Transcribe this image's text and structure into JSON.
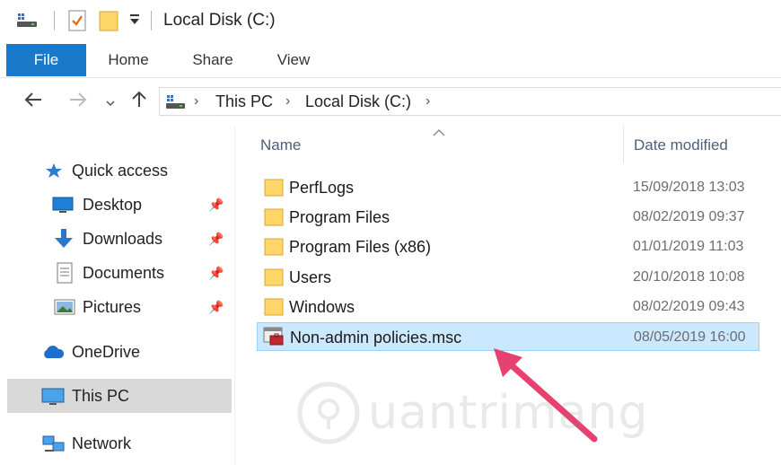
{
  "window": {
    "title": "Local Disk (C:)"
  },
  "ribbon": {
    "tabs": [
      {
        "label": "File"
      },
      {
        "label": "Home"
      },
      {
        "label": "Share"
      },
      {
        "label": "View"
      }
    ]
  },
  "address": {
    "crumbs": [
      "This PC",
      "Local Disk (C:)"
    ]
  },
  "sidebar": {
    "quick_access": "Quick access",
    "items": [
      {
        "label": "Desktop",
        "icon": "desktop-icon",
        "pinned": true
      },
      {
        "label": "Downloads",
        "icon": "download-arrow-icon",
        "pinned": true
      },
      {
        "label": "Documents",
        "icon": "documents-icon",
        "pinned": true
      },
      {
        "label": "Pictures",
        "icon": "pictures-icon",
        "pinned": true
      }
    ],
    "onedrive": "OneDrive",
    "this_pc": "This PC",
    "network": "Network"
  },
  "columns": {
    "name": "Name",
    "date_modified": "Date modified"
  },
  "files": [
    {
      "name": "PerfLogs",
      "date": "15/09/2018 13:03",
      "type": "folder"
    },
    {
      "name": "Program Files",
      "date": "08/02/2019 09:37",
      "type": "folder"
    },
    {
      "name": "Program Files (x86)",
      "date": "01/01/2019 11:03",
      "type": "folder"
    },
    {
      "name": "Users",
      "date": "20/10/2018 10:08",
      "type": "folder"
    },
    {
      "name": "Windows",
      "date": "08/02/2019 09:43",
      "type": "folder"
    },
    {
      "name": "Non-admin policies.msc",
      "date": "08/05/2019 16:00",
      "type": "msc",
      "selected": true
    }
  ],
  "watermark": "uantrimang",
  "colors": {
    "file_tab": "#1979ca",
    "selection_bg": "#cce8ff",
    "selection_border": "#99d1ff",
    "arrow": "#e8406f",
    "folder": "#ffd669"
  }
}
